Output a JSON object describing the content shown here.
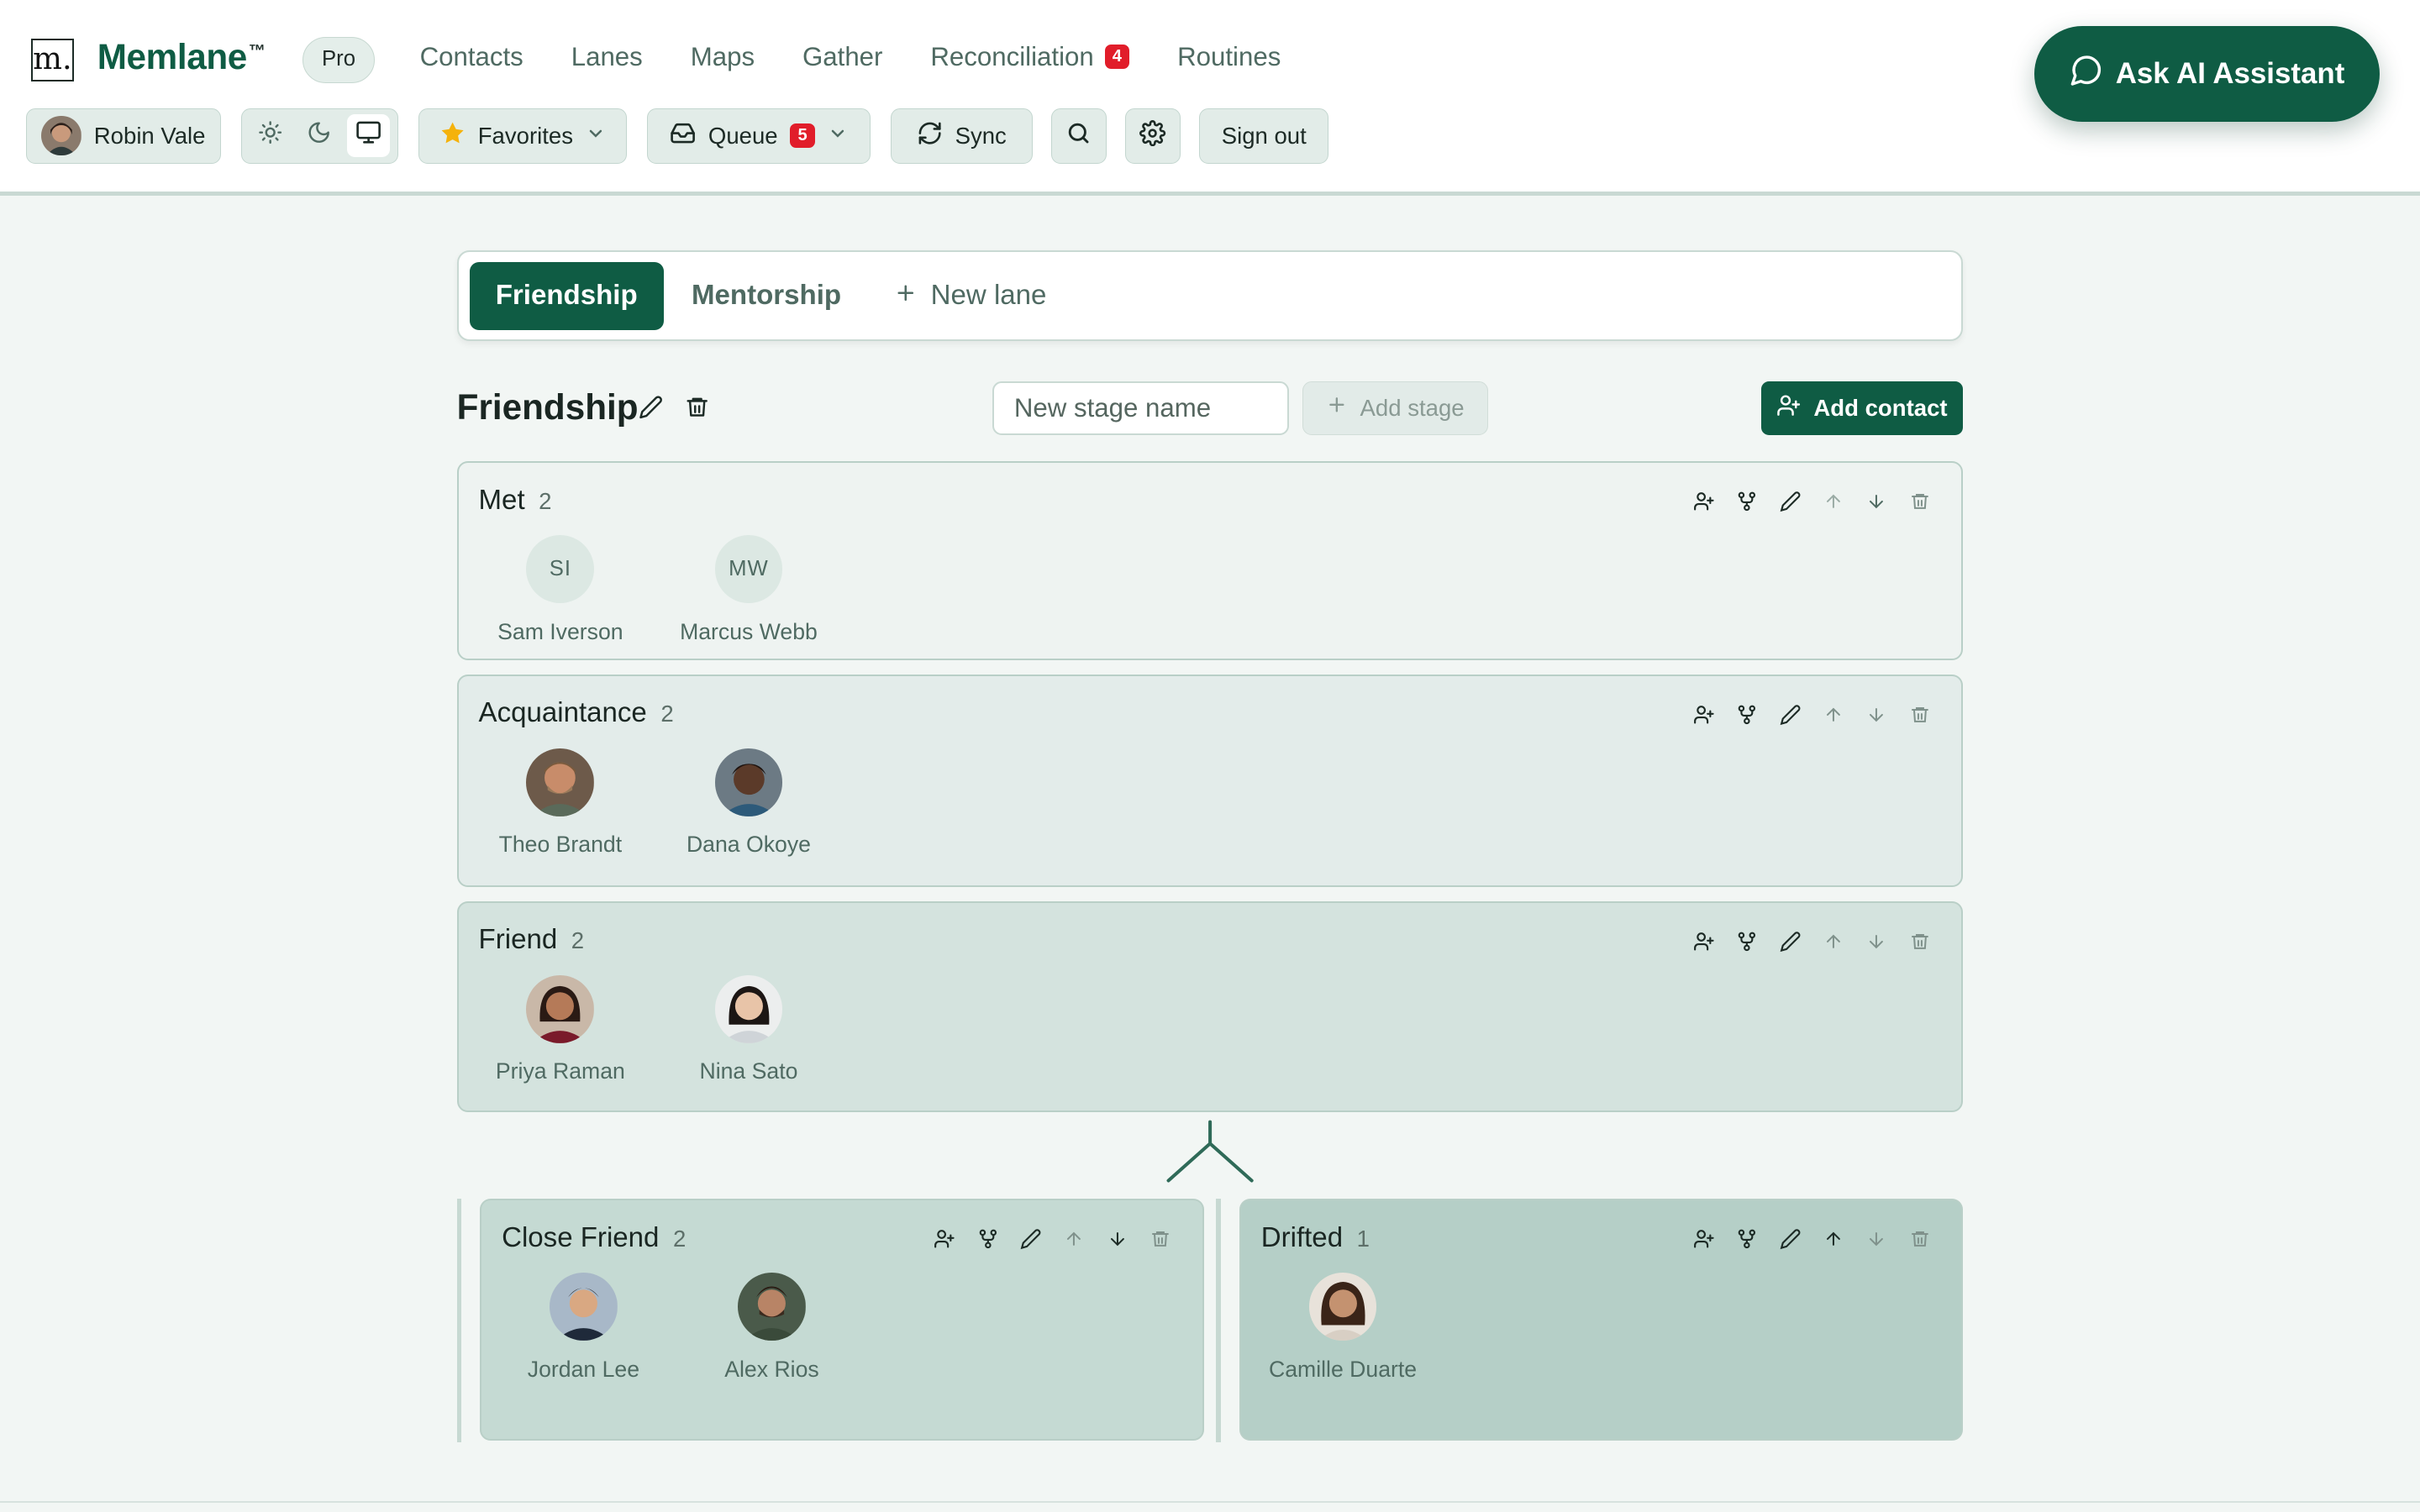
{
  "header": {
    "logo_letter": "m.",
    "brand": "Memlane",
    "brand_tm": "™",
    "plan_badge": "Pro",
    "nav": [
      {
        "label": "Contacts"
      },
      {
        "label": "Lanes"
      },
      {
        "label": "Maps"
      },
      {
        "label": "Gather"
      },
      {
        "label": "Reconciliation",
        "badge": "4"
      },
      {
        "label": "Routines"
      }
    ],
    "assistant_button": "Ask AI Assistant",
    "user_name": "Robin Vale",
    "theme_options": [
      "light",
      "dark",
      "system"
    ],
    "theme_selected": "system",
    "favorites_label": "Favorites",
    "queue_label": "Queue",
    "queue_badge": "5",
    "sync_label": "Sync",
    "sign_out_label": "Sign out",
    "colors": {
      "brand": "#0f5c44",
      "badge": "#e11d2a"
    }
  },
  "lanes": {
    "tabs": [
      {
        "label": "Friendship",
        "active": true
      },
      {
        "label": "Mentorship",
        "active": false
      }
    ],
    "new_lane_label": "New lane"
  },
  "lane": {
    "title": "Friendship",
    "stage_input_placeholder": "New stage name",
    "add_stage_label": "Add stage",
    "add_contact_label": "Add contact"
  },
  "stages": {
    "met": {
      "name": "Met",
      "count": "2",
      "contacts": [
        {
          "name": "Sam Iverson",
          "initials": "SI"
        },
        {
          "name": "Marcus Webb",
          "initials": "MW"
        }
      ]
    },
    "acquaintance": {
      "name": "Acquaintance",
      "count": "2",
      "contacts": [
        {
          "name": "Theo Brandt"
        },
        {
          "name": "Dana Okoye"
        }
      ]
    },
    "friend": {
      "name": "Friend",
      "count": "2",
      "contacts": [
        {
          "name": "Priya Raman"
        },
        {
          "name": "Nina Sato"
        }
      ]
    },
    "close_friend": {
      "name": "Close Friend",
      "count": "2",
      "contacts": [
        {
          "name": "Jordan Lee"
        },
        {
          "name": "Alex Rios"
        }
      ]
    },
    "drifted": {
      "name": "Drifted",
      "count": "1",
      "contacts": [
        {
          "name": "Camille Duarte"
        }
      ]
    }
  },
  "stage_action_icons": [
    "add-person-icon",
    "branch-icon",
    "pencil-icon",
    "arrow-up-icon",
    "arrow-down-icon",
    "trash-icon"
  ]
}
